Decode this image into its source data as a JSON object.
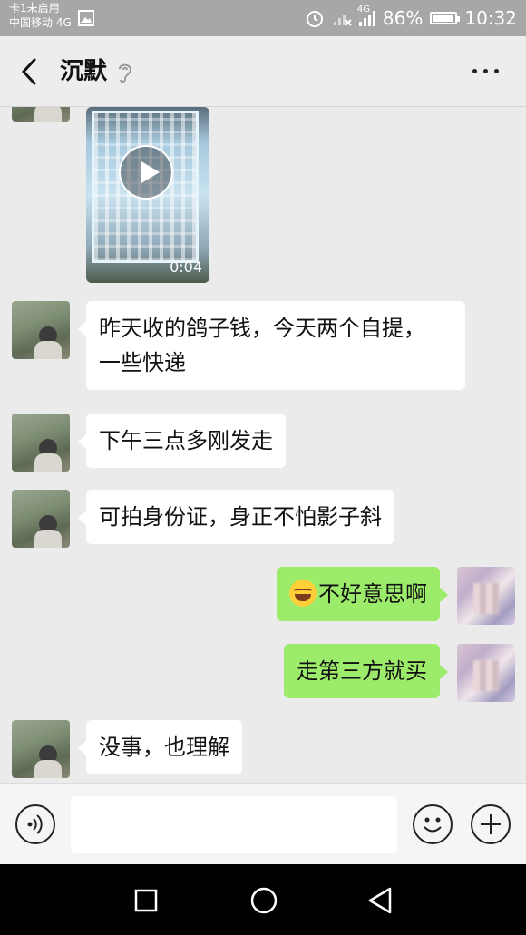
{
  "status_bar": {
    "sim1": "卡1未启用",
    "carrier": "中国移动 4G",
    "network": "4G",
    "battery": "86%",
    "battery_level": 0.86,
    "time": "10:32"
  },
  "header": {
    "title": "沉默"
  },
  "messages": [
    {
      "side": "left",
      "type": "video",
      "duration": "0:04"
    },
    {
      "side": "left",
      "type": "text",
      "line1": "昨天收的鸽子钱，今天两个自提，",
      "line2": "一些快递"
    },
    {
      "side": "left",
      "type": "text",
      "text": "下午三点多刚发走"
    },
    {
      "side": "left",
      "type": "text",
      "text": "可拍身份证，身正不怕影子斜"
    },
    {
      "side": "right",
      "type": "text",
      "text": "不好意思啊",
      "emoji": "joy-emoji"
    },
    {
      "side": "right",
      "type": "text",
      "text": "走第三方就买"
    },
    {
      "side": "left",
      "type": "text",
      "text": "没事，也理解"
    }
  ],
  "input_bar": {
    "text_value": "",
    "left_icon": "voice-icon",
    "emoji_icon": "smile-icon",
    "add_icon": "plus-icon"
  },
  "system_nav": [
    "recent-apps-icon",
    "home-icon",
    "back-triangle-icon"
  ],
  "colors": {
    "outgoing_bubble": "#9ceb6a",
    "incoming_bubble": "#ffffff",
    "chat_background": "#ebebeb",
    "status_bar": "#a7a7a7"
  }
}
